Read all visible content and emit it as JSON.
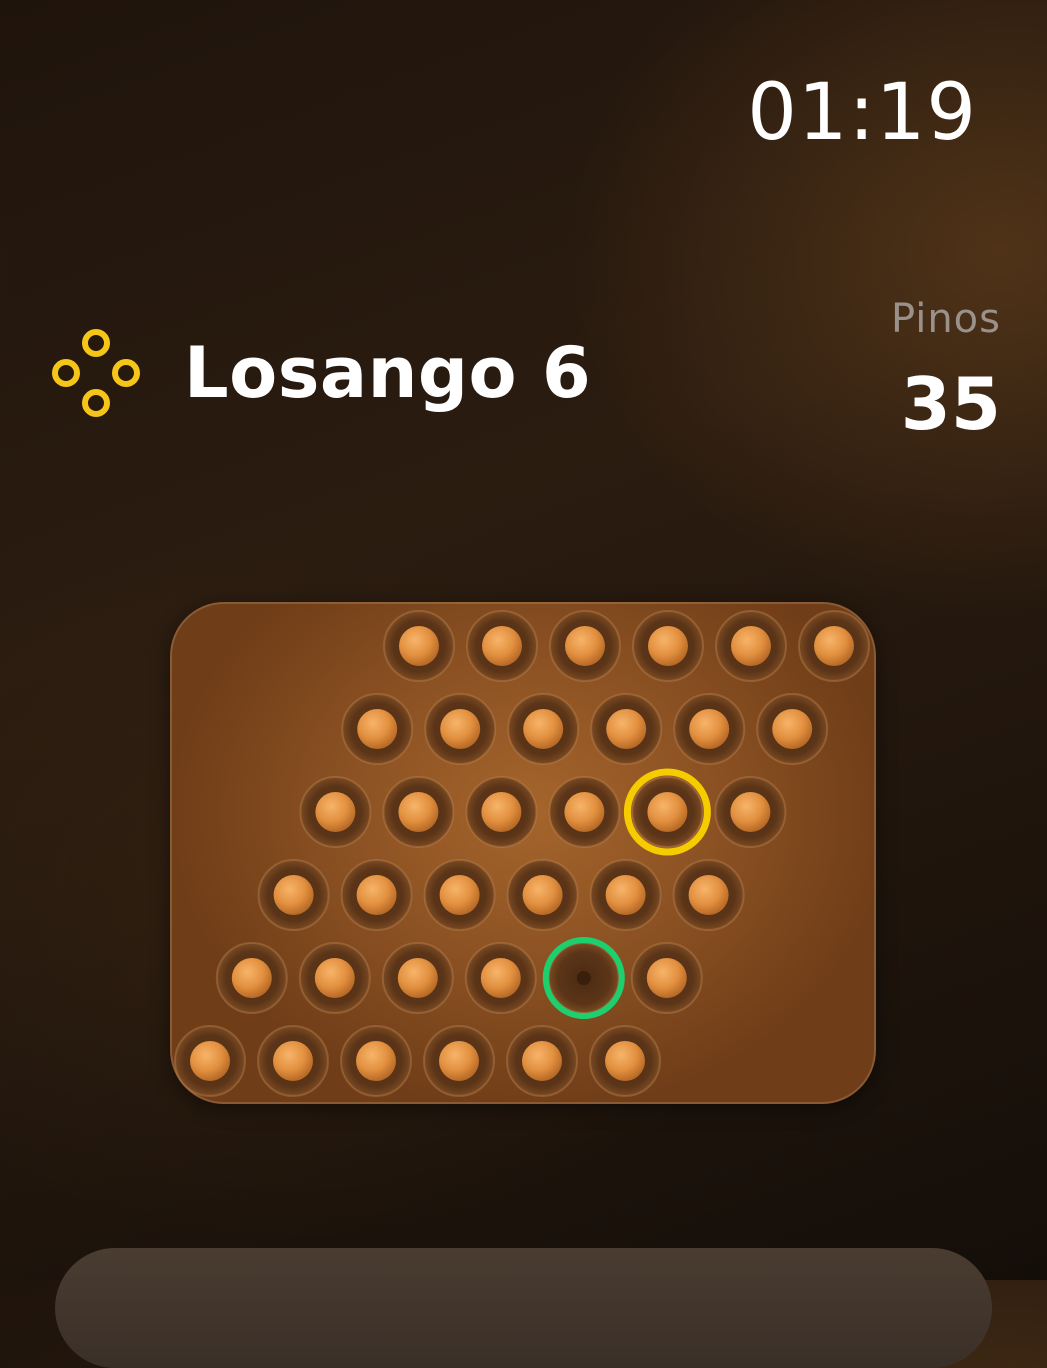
{
  "header": {
    "time": "01:19"
  },
  "level": {
    "title": "Losango 6",
    "icon": "four-circle-diamond-icon",
    "icon_color": "#f5c518"
  },
  "stats": {
    "pins_label": "Pinos",
    "pins_count": "35"
  },
  "board": {
    "shape": "rhombus",
    "rows": 6,
    "cols": 6,
    "grid": [
      [
        1,
        1,
        1,
        1,
        1,
        1
      ],
      [
        1,
        1,
        1,
        1,
        1,
        1
      ],
      [
        1,
        1,
        1,
        1,
        1,
        1
      ],
      [
        1,
        1,
        1,
        1,
        1,
        1
      ],
      [
        1,
        1,
        1,
        1,
        0,
        1
      ],
      [
        1,
        1,
        1,
        1,
        1,
        1
      ]
    ],
    "selected": {
      "row": 2,
      "col": 4,
      "color": "#f5cc00"
    },
    "target": {
      "row": 4,
      "col": 4,
      "color": "#1ecf6e"
    }
  },
  "colors": {
    "peg": "#e69a4c",
    "board": "#8f5424"
  }
}
